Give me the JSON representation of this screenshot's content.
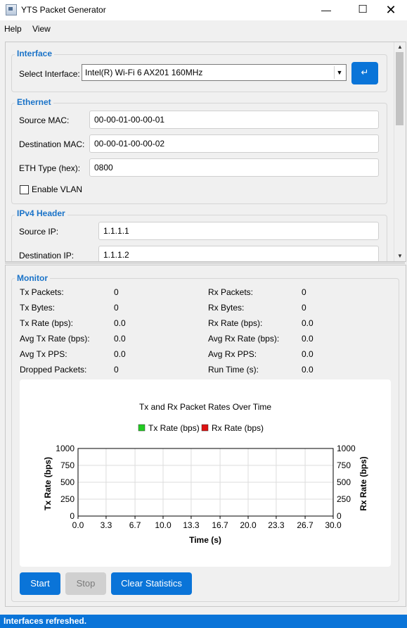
{
  "window": {
    "title": "YTS Packet Generator"
  },
  "menu": [
    "Help",
    "View"
  ],
  "interface_group": {
    "title": "Interface",
    "label": "Select Interface:",
    "selected": "Intel(R) Wi-Fi 6 AX201 160MHz",
    "refresh_icon": "refresh-icon"
  },
  "ethernet": {
    "title": "Ethernet",
    "source_mac_label": "Source MAC:",
    "source_mac": "00-00-01-00-00-01",
    "dest_mac_label": "Destination MAC:",
    "dest_mac": "00-00-01-00-00-02",
    "eth_type_label": "ETH Type (hex):",
    "eth_type": "0800",
    "vlan_label": "Enable VLAN",
    "vlan_checked": false
  },
  "ipv4": {
    "title": "IPv4 Header",
    "source_ip_label": "Source IP:",
    "source_ip": "1.1.1.1",
    "dest_ip_label": "Destination IP:",
    "dest_ip": "1.1.1.2"
  },
  "monitor": {
    "title": "Monitor",
    "tx": [
      {
        "label": "Tx Packets:",
        "value": "0"
      },
      {
        "label": "Tx Bytes:",
        "value": "0"
      },
      {
        "label": "Tx Rate (bps):",
        "value": "0.0"
      },
      {
        "label": "Avg Tx Rate (bps):",
        "value": "0.0"
      },
      {
        "label": "Avg Tx PPS:",
        "value": "0.0"
      },
      {
        "label": "Dropped Packets:",
        "value": "0"
      }
    ],
    "rx": [
      {
        "label": "Rx Packets:",
        "value": "0"
      },
      {
        "label": "Rx Bytes:",
        "value": "0"
      },
      {
        "label": "Rx Rate (bps):",
        "value": "0.0"
      },
      {
        "label": "Avg Rx Rate (bps):",
        "value": "0.0"
      },
      {
        "label": "Avg Rx PPS:",
        "value": "0.0"
      },
      {
        "label": "Run Time (s):",
        "value": "0.0"
      }
    ]
  },
  "chart_data": {
    "type": "line",
    "title": "Tx and Rx Packet Rates Over Time",
    "xlabel": "Time (s)",
    "ylabel_left": "Tx Rate (bps)",
    "ylabel_right": "Rx Rate (bps)",
    "xlim": [
      0,
      30
    ],
    "ylim": [
      0,
      1000
    ],
    "x_ticks": [
      "0.0",
      "3.3",
      "6.7",
      "10.0",
      "13.3",
      "16.7",
      "20.0",
      "23.3",
      "26.7",
      "30.0"
    ],
    "y_ticks": [
      "0",
      "250",
      "500",
      "750",
      "1000"
    ],
    "grid": true,
    "legend_position": "top",
    "series": [
      {
        "name": "Tx Rate (bps)",
        "color": "#22cc22",
        "values": []
      },
      {
        "name": "Rx Rate (bps)",
        "color": "#dd1111",
        "values": []
      }
    ]
  },
  "buttons": {
    "start": "Start",
    "stop": "Stop",
    "clear": "Clear Statistics"
  },
  "status": "Interfaces refreshed.",
  "colors": {
    "accent": "#0a74d8",
    "group_title": "#1a73c8"
  }
}
